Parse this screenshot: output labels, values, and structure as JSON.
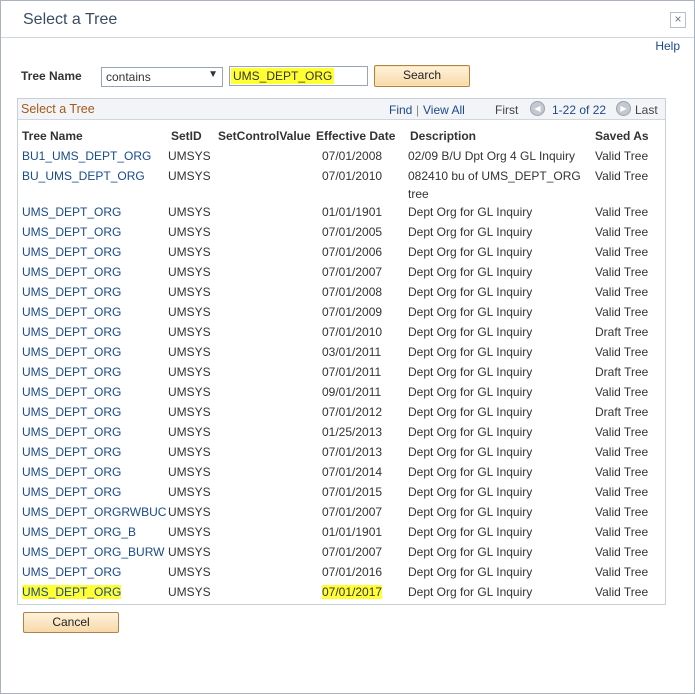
{
  "dialog": {
    "title": "Select a Tree",
    "close_glyph": "×",
    "help_label": "Help"
  },
  "search": {
    "label": "Tree Name",
    "operator": "contains",
    "value": "UMS_DEPT_ORG",
    "button_label": "Search"
  },
  "grid": {
    "title": "Select a Tree",
    "find_label": "Find",
    "separator": "|",
    "view_all_label": "View All",
    "first_label": "First",
    "range_label": "1-22 of 22",
    "last_label": "Last",
    "columns": [
      "Tree Name",
      "SetID",
      "SetControlValue",
      "Effective Date",
      "Description",
      "Saved As"
    ],
    "rows": [
      {
        "tree": "BU1_UMS_DEPT_ORG",
        "setid": "UMSYS",
        "scv": "",
        "date": "07/01/2008",
        "desc": "02/09 B/U Dpt Org 4 GL Inquiry",
        "desc2": "",
        "saved": "Valid Tree"
      },
      {
        "tree": "BU_UMS_DEPT_ORG",
        "setid": "UMSYS",
        "scv": "",
        "date": "07/01/2010",
        "desc": "082410 bu of UMS_DEPT_ORG",
        "desc2": "tree",
        "saved": "Valid Tree"
      },
      {
        "tree": "UMS_DEPT_ORG",
        "setid": "UMSYS",
        "scv": "",
        "date": "01/01/1901",
        "desc": "Dept Org for GL Inquiry",
        "desc2": "",
        "saved": "Valid Tree"
      },
      {
        "tree": "UMS_DEPT_ORG",
        "setid": "UMSYS",
        "scv": "",
        "date": "07/01/2005",
        "desc": "Dept Org for GL Inquiry",
        "desc2": "",
        "saved": "Valid Tree"
      },
      {
        "tree": "UMS_DEPT_ORG",
        "setid": "UMSYS",
        "scv": "",
        "date": "07/01/2006",
        "desc": "Dept Org for GL Inquiry",
        "desc2": "",
        "saved": "Valid Tree"
      },
      {
        "tree": "UMS_DEPT_ORG",
        "setid": "UMSYS",
        "scv": "",
        "date": "07/01/2007",
        "desc": "Dept Org for GL Inquiry",
        "desc2": "",
        "saved": "Valid Tree"
      },
      {
        "tree": "UMS_DEPT_ORG",
        "setid": "UMSYS",
        "scv": "",
        "date": "07/01/2008",
        "desc": "Dept Org for GL Inquiry",
        "desc2": "",
        "saved": "Valid Tree"
      },
      {
        "tree": "UMS_DEPT_ORG",
        "setid": "UMSYS",
        "scv": "",
        "date": "07/01/2009",
        "desc": "Dept Org for GL Inquiry",
        "desc2": "",
        "saved": "Valid Tree"
      },
      {
        "tree": "UMS_DEPT_ORG",
        "setid": "UMSYS",
        "scv": "",
        "date": "07/01/2010",
        "desc": "Dept Org for GL Inquiry",
        "desc2": "",
        "saved": "Draft Tree"
      },
      {
        "tree": "UMS_DEPT_ORG",
        "setid": "UMSYS",
        "scv": "",
        "date": "03/01/2011",
        "desc": "Dept Org for GL Inquiry",
        "desc2": "",
        "saved": "Valid Tree"
      },
      {
        "tree": "UMS_DEPT_ORG",
        "setid": "UMSYS",
        "scv": "",
        "date": "07/01/2011",
        "desc": "Dept Org for GL Inquiry",
        "desc2": "",
        "saved": "Draft Tree"
      },
      {
        "tree": "UMS_DEPT_ORG",
        "setid": "UMSYS",
        "scv": "",
        "date": "09/01/2011",
        "desc": "Dept Org for GL Inquiry",
        "desc2": "",
        "saved": "Valid Tree"
      },
      {
        "tree": "UMS_DEPT_ORG",
        "setid": "UMSYS",
        "scv": "",
        "date": "07/01/2012",
        "desc": "Dept Org for GL Inquiry",
        "desc2": "",
        "saved": "Draft Tree"
      },
      {
        "tree": "UMS_DEPT_ORG",
        "setid": "UMSYS",
        "scv": "",
        "date": "01/25/2013",
        "desc": "Dept Org for GL Inquiry",
        "desc2": "",
        "saved": "Valid Tree"
      },
      {
        "tree": "UMS_DEPT_ORG",
        "setid": "UMSYS",
        "scv": "",
        "date": "07/01/2013",
        "desc": "Dept Org for GL Inquiry",
        "desc2": "",
        "saved": "Valid Tree"
      },
      {
        "tree": "UMS_DEPT_ORG",
        "setid": "UMSYS",
        "scv": "",
        "date": "07/01/2014",
        "desc": "Dept Org for GL Inquiry",
        "desc2": "",
        "saved": "Valid Tree"
      },
      {
        "tree": "UMS_DEPT_ORG",
        "setid": "UMSYS",
        "scv": "",
        "date": "07/01/2015",
        "desc": "Dept Org for GL Inquiry",
        "desc2": "",
        "saved": "Valid Tree"
      },
      {
        "tree": "UMS_DEPT_ORGRWBUC",
        "setid": "UMSYS",
        "scv": "",
        "date": "07/01/2007",
        "desc": "Dept Org for GL Inquiry",
        "desc2": "",
        "saved": "Valid Tree"
      },
      {
        "tree": "UMS_DEPT_ORG_B",
        "setid": "UMSYS",
        "scv": "",
        "date": "01/01/1901",
        "desc": "Dept Org for GL Inquiry",
        "desc2": "",
        "saved": "Valid Tree"
      },
      {
        "tree": "UMS_DEPT_ORG_BURW",
        "setid": "UMSYS",
        "scv": "",
        "date": "07/01/2007",
        "desc": "Dept Org for GL Inquiry",
        "desc2": "",
        "saved": "Valid Tree"
      },
      {
        "tree": "UMS_DEPT_ORG",
        "setid": "UMSYS",
        "scv": "",
        "date": "07/01/2016",
        "desc": "Dept Org for GL Inquiry",
        "desc2": "",
        "saved": "Valid Tree"
      },
      {
        "tree": "UMS_DEPT_ORG",
        "setid": "UMSYS",
        "scv": "",
        "date": "07/01/2017",
        "desc": "Dept Org for GL Inquiry",
        "desc2": "",
        "saved": "Valid Tree",
        "highlight": true
      }
    ]
  },
  "footer": {
    "cancel_label": "Cancel"
  },
  "colors": {
    "link": "#1a4a8a",
    "highlight": "#ffff33",
    "grid_title": "#a25a1a"
  }
}
